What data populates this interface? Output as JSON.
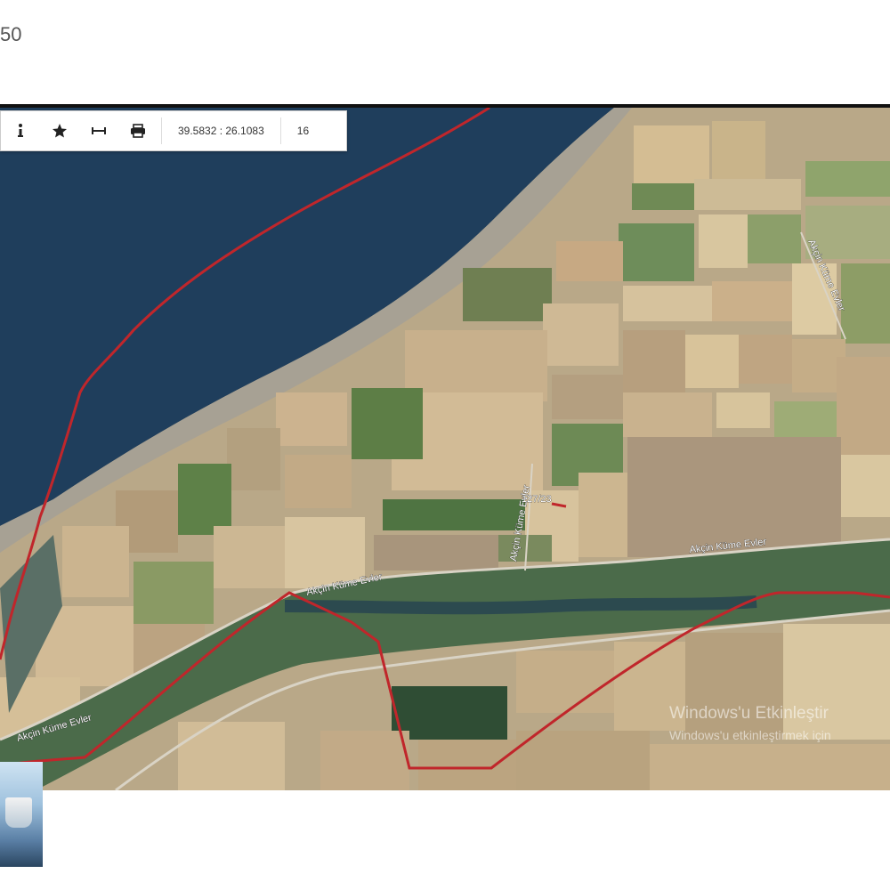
{
  "page": {
    "top_label": "50"
  },
  "toolbar": {
    "info_icon": "info-icon",
    "favorite_icon": "star-icon",
    "measure_icon": "ruler-icon",
    "print_icon": "printer-icon",
    "coordinates": "39.5832 : 26.1083",
    "zoom_level": "16"
  },
  "map": {
    "road_labels": [
      "Akçin Küme Evler",
      "Akçin Küme Evler",
      "Akçin Küme Evler",
      "Akçin Küme Evler",
      "Akçin Küme Evler"
    ],
    "parcel_label": "127/23",
    "boundary_color": "#c0262b",
    "sea_color": "#1e3f5e"
  },
  "watermark": {
    "line1": "Windows'u Etkinleştir",
    "line2": "Windows'u etkinleştirmek için"
  }
}
